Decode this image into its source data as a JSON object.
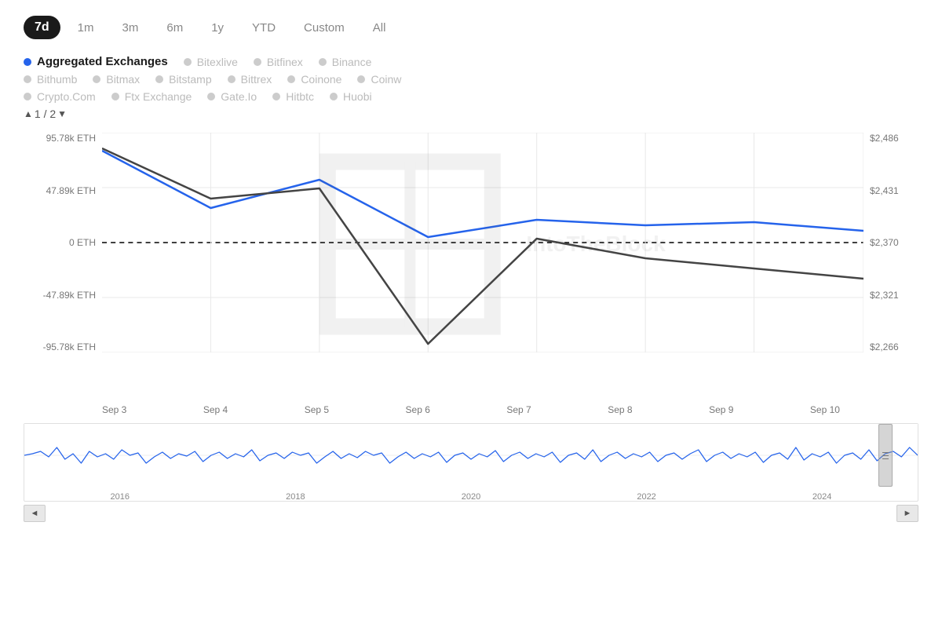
{
  "timeRange": {
    "buttons": [
      {
        "label": "7d",
        "active": true
      },
      {
        "label": "1m",
        "active": false
      },
      {
        "label": "3m",
        "active": false
      },
      {
        "label": "6m",
        "active": false
      },
      {
        "label": "1y",
        "active": false
      },
      {
        "label": "YTD",
        "active": false
      },
      {
        "label": "Custom",
        "active": false
      },
      {
        "label": "All",
        "active": false
      }
    ]
  },
  "legend": {
    "rows": [
      [
        {
          "label": "Aggregated Exchanges",
          "color": "#2563eb",
          "active": true
        },
        {
          "label": "Bitexlive",
          "color": "#ccc",
          "active": false
        },
        {
          "label": "Bitfinex",
          "color": "#ccc",
          "active": false
        },
        {
          "label": "Binance",
          "color": "#ccc",
          "active": false
        }
      ],
      [
        {
          "label": "Bithumb",
          "color": "#ccc",
          "active": false
        },
        {
          "label": "Bitmax",
          "color": "#ccc",
          "active": false
        },
        {
          "label": "Bitstamp",
          "color": "#ccc",
          "active": false
        },
        {
          "label": "Bittrex",
          "color": "#ccc",
          "active": false
        },
        {
          "label": "Coinone",
          "color": "#ccc",
          "active": false
        },
        {
          "label": "Coinw",
          "color": "#ccc",
          "active": false
        }
      ],
      [
        {
          "label": "Crypto.Com",
          "color": "#ccc",
          "active": false
        },
        {
          "label": "Ftx Exchange",
          "color": "#ccc",
          "active": false
        },
        {
          "label": "Gate.Io",
          "color": "#ccc",
          "active": false
        },
        {
          "label": "Hitbtc",
          "color": "#ccc",
          "active": false
        },
        {
          "label": "Huobi",
          "color": "#ccc",
          "active": false
        }
      ]
    ]
  },
  "pagination": {
    "current": "1",
    "total": "2"
  },
  "yAxisLeft": [
    "95.78k ETH",
    "47.89k ETH",
    "0 ETH",
    "-47.89k ETH",
    "-95.78k ETH"
  ],
  "yAxisRight": [
    "$2,486",
    "$2,431",
    "$2,370",
    "$2,321",
    "$2,266"
  ],
  "xAxisLabels": [
    "Sep 3",
    "Sep 4",
    "Sep 5",
    "Sep 6",
    "Sep 7",
    "Sep 8",
    "Sep 9",
    "Sep 10"
  ],
  "miniXAxisLabels": [
    "2016",
    "2018",
    "2020",
    "2022",
    "2024"
  ],
  "navButtons": {
    "left": "◄",
    "right": "►"
  }
}
